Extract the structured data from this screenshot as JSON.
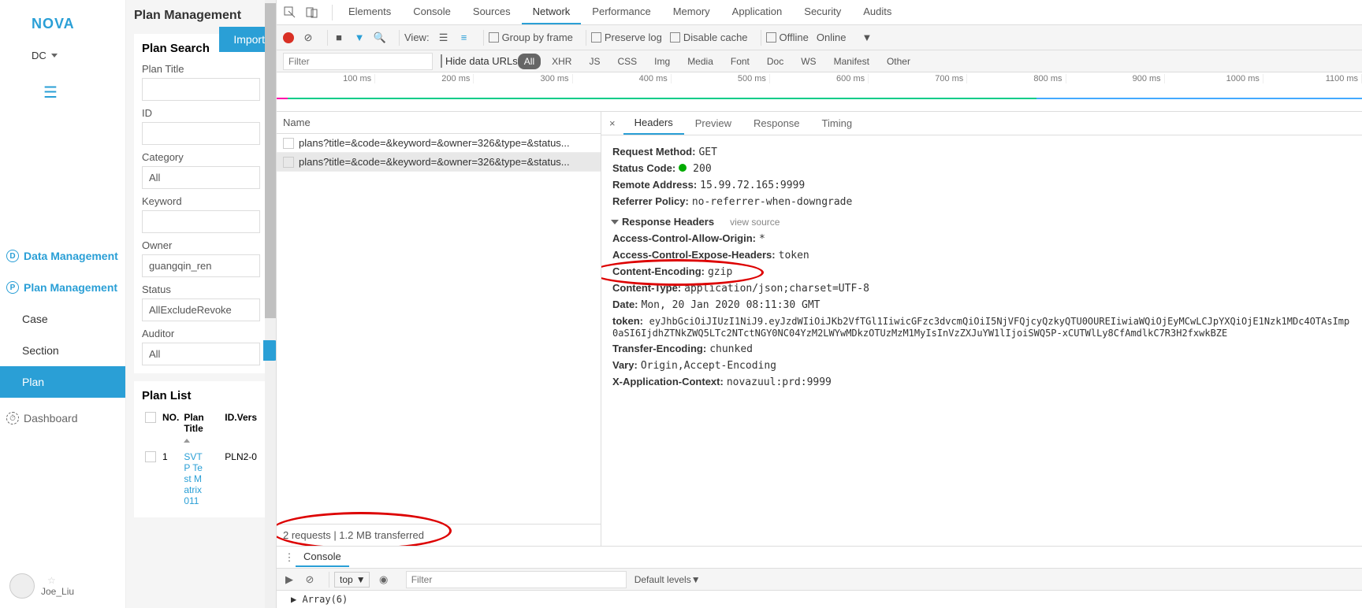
{
  "app": {
    "logo": "NOVA",
    "user_top": "DC",
    "nav": {
      "data_mgmt": "Data Management",
      "plan_mgmt": "Plan Management",
      "case": "Case",
      "section": "Section",
      "plan": "Plan",
      "dashboard": "Dashboard"
    },
    "footer_user": "Joe_Liu"
  },
  "plan_panel": {
    "title": "Plan Management",
    "import": "Import",
    "search_title": "Plan Search",
    "fields": {
      "plan_title": "Plan Title",
      "id": "ID",
      "category": "Category",
      "category_val": "All",
      "keyword": "Keyword",
      "owner": "Owner",
      "owner_val": "guangqin_ren",
      "status": "Status",
      "status_val": "AllExcludeRevoke",
      "auditor": "Auditor",
      "auditor_val": "All"
    },
    "list_title": "Plan List",
    "cols": {
      "no": "NO.",
      "title": "Plan Title",
      "idvers": "ID.Vers"
    },
    "rows": [
      {
        "no": "1",
        "title_lines": [
          "SVT",
          "P Te",
          "st M",
          "atrix",
          "011"
        ],
        "idvers": "PLN2-0"
      }
    ]
  },
  "devtools": {
    "tabs": [
      "Elements",
      "Console",
      "Sources",
      "Network",
      "Performance",
      "Memory",
      "Application",
      "Security",
      "Audits"
    ],
    "active_tab": "Network",
    "toolbar": {
      "view": "View:",
      "group": "Group by frame",
      "preserve": "Preserve log",
      "disable_cache": "Disable cache",
      "offline": "Offline",
      "online": "Online"
    },
    "filter": {
      "placeholder": "Filter",
      "hide_urls": "Hide data URLs",
      "types": [
        "All",
        "XHR",
        "JS",
        "CSS",
        "Img",
        "Media",
        "Font",
        "Doc",
        "WS",
        "Manifest",
        "Other"
      ],
      "active": "All"
    },
    "timeline": [
      "100 ms",
      "200 ms",
      "300 ms",
      "400 ms",
      "500 ms",
      "600 ms",
      "700 ms",
      "800 ms",
      "900 ms",
      "1000 ms",
      "1100 ms"
    ],
    "requests": {
      "head": "Name",
      "items": [
        "plans?title=&code=&keyword=&owner=326&type=&status...",
        "plans?title=&code=&keyword=&owner=326&type=&status..."
      ],
      "status": "2 requests  |  1.2 MB transferred"
    },
    "detail": {
      "tabs": [
        "Headers",
        "Preview",
        "Response",
        "Timing"
      ],
      "active": "Headers",
      "general": {
        "method_k": "Request Method:",
        "method_v": "GET",
        "status_k": "Status Code:",
        "status_v": "200",
        "remote_k": "Remote Address:",
        "remote_v": "15.99.72.165:9999",
        "referrer_k": "Referrer Policy:",
        "referrer_v": "no-referrer-when-downgrade"
      },
      "resp_head": "Response Headers",
      "view_source": "view source",
      "resp": {
        "acao_k": "Access-Control-Allow-Origin:",
        "acao_v": "*",
        "aceh_k": "Access-Control-Expose-Headers:",
        "aceh_v": "token",
        "ce_k": "Content-Encoding:",
        "ce_v": "gzip",
        "ct_k": "Content-Type:",
        "ct_v": "application/json;charset=UTF-8",
        "date_k": "Date:",
        "date_v": "Mon, 20 Jan 2020 08:11:30 GMT",
        "token_k": "token:",
        "token_v": "eyJhbGciOiJIUzI1NiJ9.eyJzdWIiOiJKb2VfTGl1IiwicGFzc3dvcmQiOiI5NjVFQjcyQzkyQTU0OUREIiwiaWQiOjEyMCwLCJpYXQiOjE1Nzk1MDc4OTAsImp0aSI6IjdhZTNkZWQ5LTc2NTctNGY0NC04YzM2LWYwMDkzOTUzMzM1MyIsInVzZXJuYW1lIjoiSWQ5P-xCUTWlLy8CfAmdlkC7R3H2fxwkBZE",
        "te_k": "Transfer-Encoding:",
        "te_v": "chunked",
        "vary_k": "Vary:",
        "vary_v": "Origin,Accept-Encoding",
        "xac_k": "X-Application-Context:",
        "xac_v": "novazuul:prd:9999"
      }
    },
    "console": {
      "title": "Console",
      "context": "top",
      "filter_ph": "Filter",
      "levels": "Default levels",
      "body": "▶ Array(6)"
    }
  }
}
